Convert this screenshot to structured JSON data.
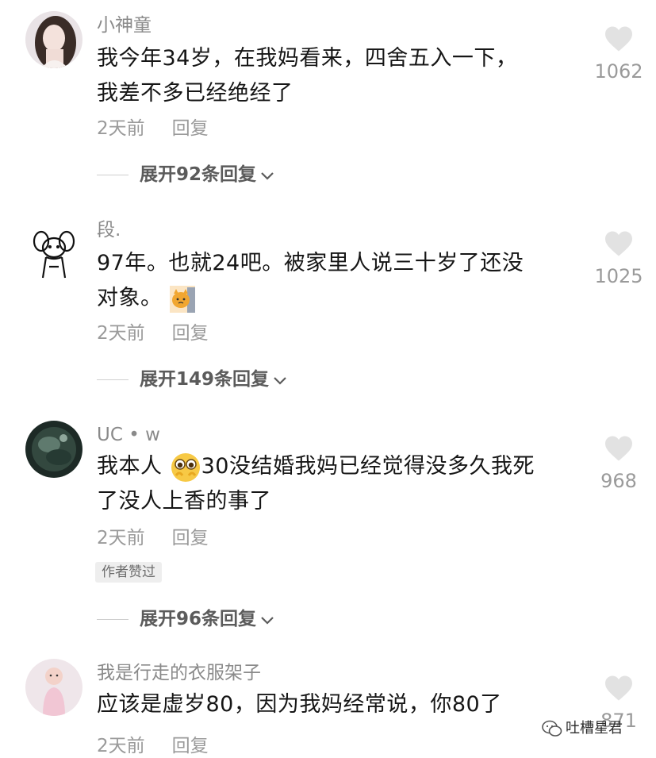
{
  "comments": [
    {
      "username": "小神童",
      "text_lines": [
        "我今年34岁，在我妈看来，四舍五入一下，",
        "我差不多已经绝经了"
      ],
      "time": "2天前",
      "reply": "回复",
      "likes": "1062",
      "expand": "展开92条回复"
    },
    {
      "username": "段.",
      "text_lines": [
        "97年。也就24吧。被家里人说三十岁了还没",
        "对象。"
      ],
      "time": "2天前",
      "reply": "回复",
      "likes": "1025",
      "expand": "展开149条回复"
    },
    {
      "username": "UC • w",
      "text_a": "我本人",
      "text_b": "30没结婚我妈已经觉得没多久我死",
      "text_line2": "了没人上香的事了",
      "time": "2天前",
      "reply": "回复",
      "badge": "作者赞过",
      "likes": "968",
      "expand": "展开96条回复"
    },
    {
      "username": "我是行走的衣服架子",
      "text_lines": [
        "应该是虚岁80，因为我妈经常说，你80了"
      ],
      "time": "2天前",
      "reply": "回复",
      "likes": "871"
    }
  ],
  "watermark": "吐槽星君",
  "icons": {
    "like": "heart-icon",
    "expand": "chevron-down-icon",
    "watermark": "wechat-icon"
  },
  "colors": {
    "text": "#161616",
    "muted": "#9a9a9a",
    "heart": "#e2e2e2"
  }
}
